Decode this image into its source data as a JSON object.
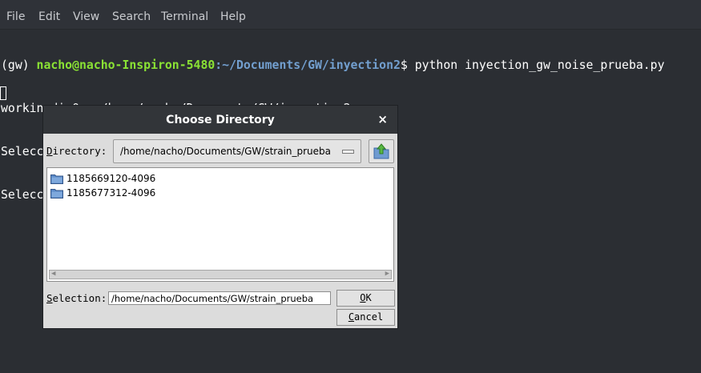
{
  "menubar": {
    "items": [
      "File",
      "Edit",
      "View",
      "Search",
      "Terminal",
      "Help"
    ]
  },
  "terminal": {
    "env": "(gw) ",
    "user_host": "nacho@nacho-Inspiron-5480",
    "path": ":~/Documents/GW/inyection2",
    "command": "$ python inyection_gw_noise_prueba.py",
    "lines": [
      "workingdir0:  /home/nacho/Documents/GW/inyection2",
      "Seleccione la carpeta de las plantillas:",
      "Seleccione la carpeta de los segmentos de ruido:"
    ]
  },
  "dialog": {
    "title": "Choose Directory",
    "close": "×",
    "directory_label_key": "D",
    "directory_label_rest": "irectory:",
    "directory_value": "/home/nacho/Documents/GW/strain_prueba",
    "folders": [
      "1185669120-4096",
      "1185677312-4096"
    ],
    "selection_label_key": "S",
    "selection_label_rest": "election:",
    "selection_value": "/home/nacho/Documents/GW/strain_prueba",
    "ok_key": "O",
    "ok_rest": "K",
    "cancel_key": "C",
    "cancel_rest": "ancel"
  },
  "colors": {
    "terminal_bg": "#2b2e33",
    "prompt_user": "#8ae234",
    "prompt_path": "#729fcf",
    "dialog_bg": "#dcdcdc",
    "titlebar_bg": "#323539",
    "folder_icon": "#5b8ac8"
  }
}
